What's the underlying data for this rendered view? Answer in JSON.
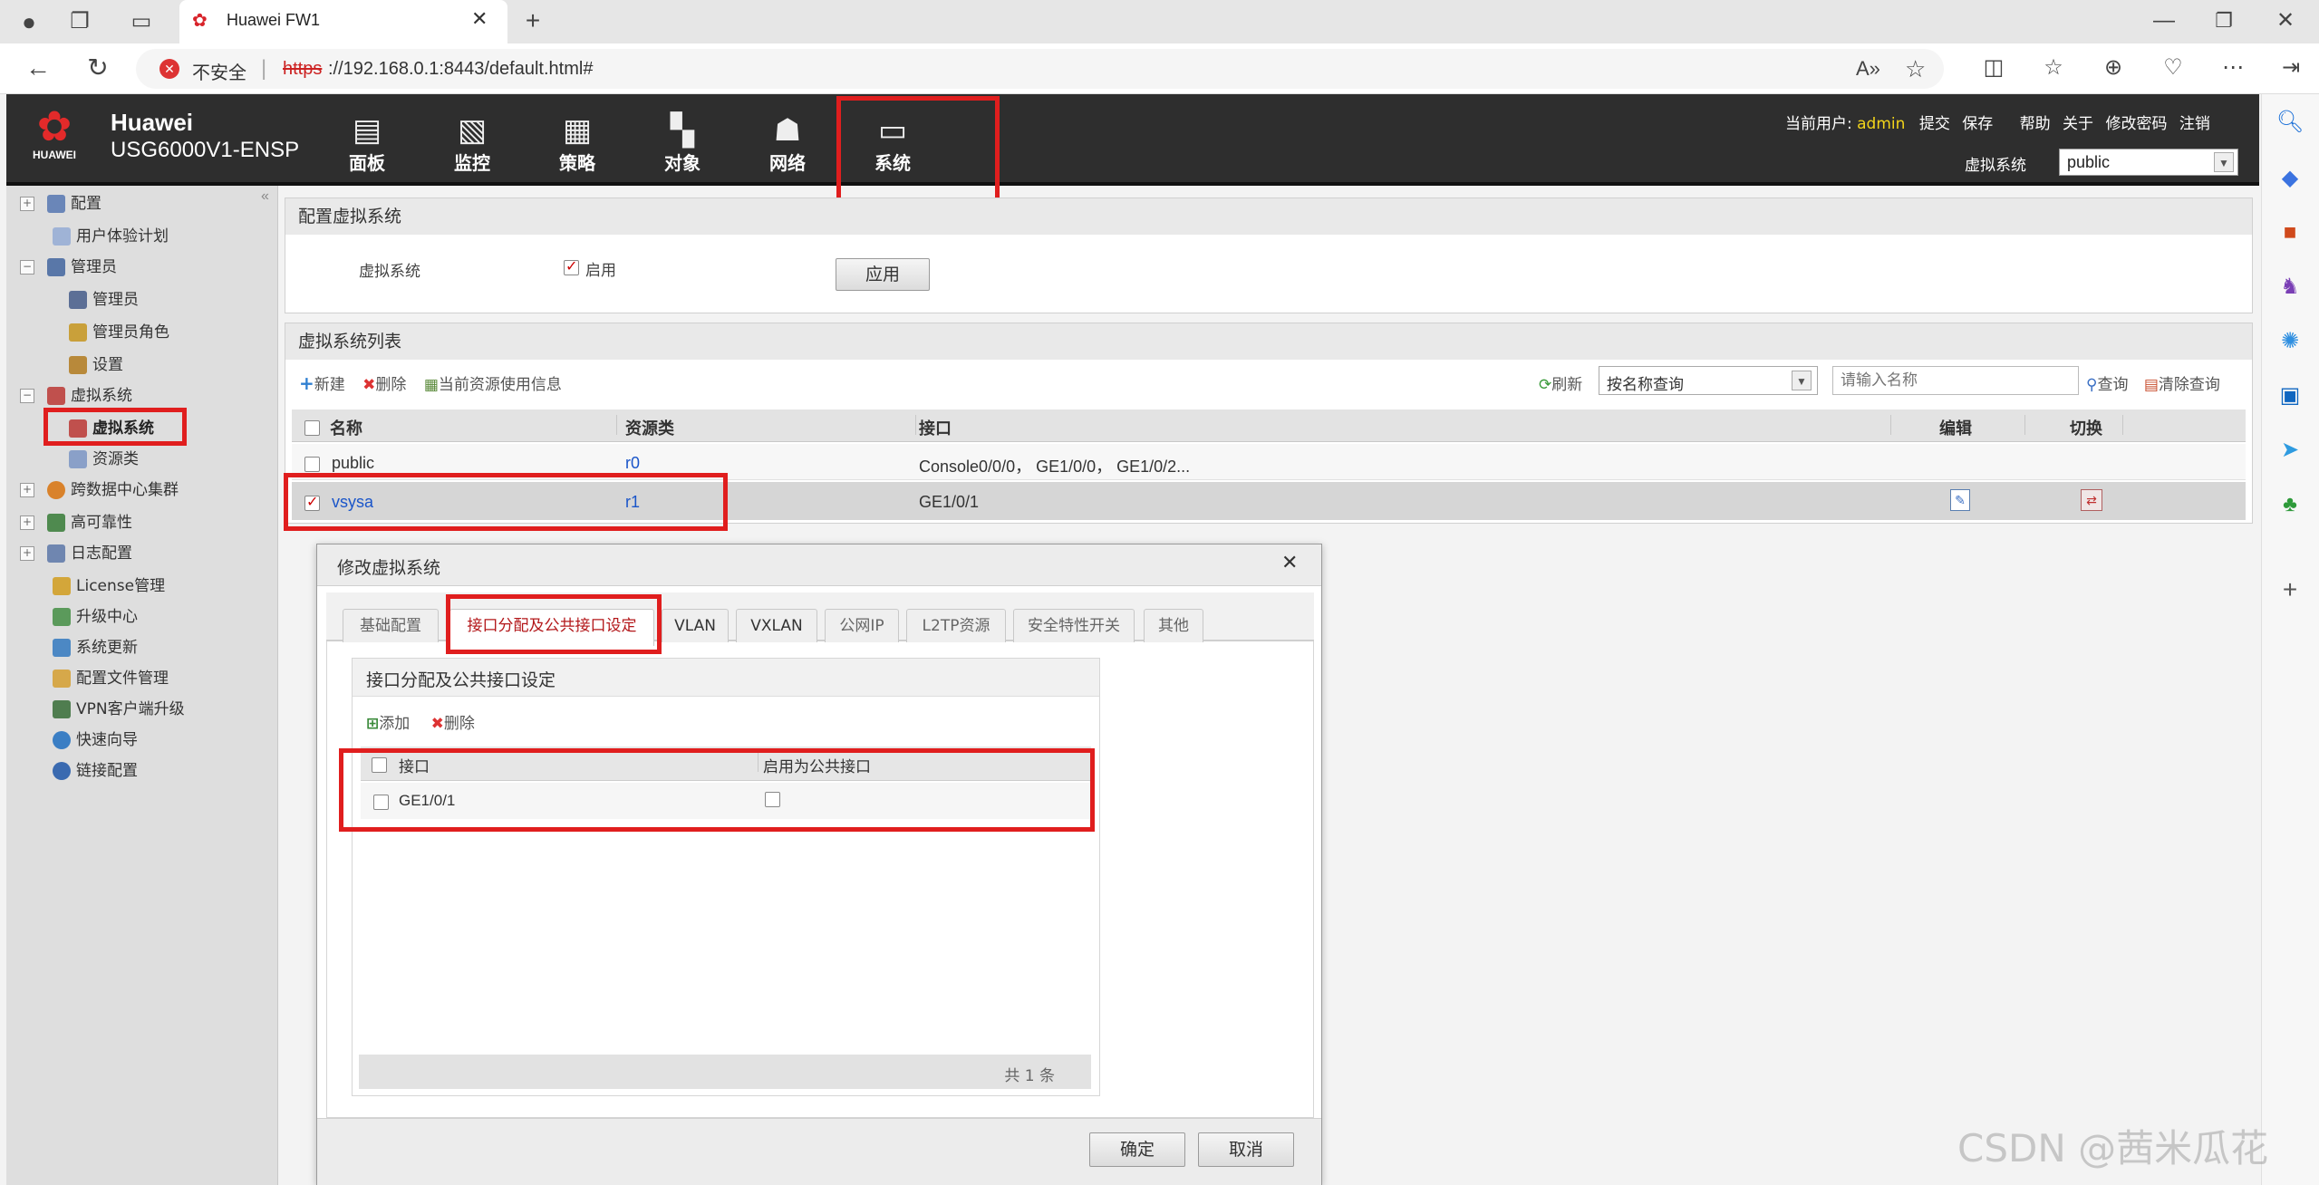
{
  "browser": {
    "tab_title": "Huawei FW1",
    "security_label": "不安全",
    "url_scheme": "https",
    "url_rest": "://192.168.0.1:8443/default.html#"
  },
  "header": {
    "brand": "Huawei",
    "logo_text": "HUAWEI",
    "model": "USG6000V1-ENSP",
    "nav": [
      {
        "label": "面板",
        "icon": "dashboard-icon"
      },
      {
        "label": "监控",
        "icon": "monitor-icon"
      },
      {
        "label": "策略",
        "icon": "policy-icon"
      },
      {
        "label": "对象",
        "icon": "object-icon"
      },
      {
        "label": "网络",
        "icon": "network-icon"
      },
      {
        "label": "系统",
        "icon": "system-icon"
      }
    ],
    "current_user_label": "当前用户:",
    "current_user": "admin",
    "links": [
      "提交",
      "保存",
      "帮助",
      "关于",
      "修改密码",
      "注销"
    ],
    "vsys_label": "虚拟系统",
    "vsys_value": "public"
  },
  "tree": {
    "items": [
      {
        "label": "配置",
        "expander": "+"
      },
      {
        "label": "用户体验计划",
        "expander": ""
      },
      {
        "label": "管理员",
        "expander": "−"
      },
      {
        "label": "管理员",
        "expander": ""
      },
      {
        "label": "管理员角色",
        "expander": ""
      },
      {
        "label": "设置",
        "expander": ""
      },
      {
        "label": "虚拟系统",
        "expander": "−"
      },
      {
        "label": "虚拟系统",
        "expander": ""
      },
      {
        "label": "资源类",
        "expander": ""
      },
      {
        "label": "跨数据中心集群",
        "expander": "+"
      },
      {
        "label": "高可靠性",
        "expander": "+"
      },
      {
        "label": "日志配置",
        "expander": "+"
      },
      {
        "label": "License管理",
        "expander": ""
      },
      {
        "label": "升级中心",
        "expander": ""
      },
      {
        "label": "系统更新",
        "expander": ""
      },
      {
        "label": "配置文件管理",
        "expander": ""
      },
      {
        "label": "VPN客户端升级",
        "expander": ""
      },
      {
        "label": "快速向导",
        "expander": ""
      },
      {
        "label": "链接配置",
        "expander": ""
      }
    ]
  },
  "config_panel": {
    "title": "配置虚拟系统",
    "field_label": "虚拟系统",
    "enable_label": "启用",
    "apply_label": "应用"
  },
  "list_panel": {
    "title": "虚拟系统列表",
    "toolbar": {
      "new": "新建",
      "delete": "删除",
      "usage": "当前资源使用信息",
      "refresh": "刷新",
      "query_type": "按名称查询",
      "search_placeholder": "请输入名称",
      "query": "查询",
      "clear": "清除查询"
    },
    "columns": [
      "名称",
      "资源类",
      "接口",
      "编辑",
      "切换"
    ],
    "rows": [
      {
        "name": "public",
        "resource": "r0",
        "interfaces": "Console0/0/0， GE1/0/0， GE1/0/2..."
      },
      {
        "name": "vsysa",
        "resource": "r1",
        "interfaces": "GE1/0/1"
      }
    ]
  },
  "dialog": {
    "title": "修改虚拟系统",
    "tabs": [
      "基础配置",
      "接口分配及公共接口设定",
      "VLAN",
      "VXLAN",
      "公网IP",
      "L2TP资源",
      "安全特性开关",
      "其他"
    ],
    "section_title": "接口分配及公共接口设定",
    "add_label": "添加",
    "delete_label": "删除",
    "columns": [
      "接口",
      "启用为公共接口"
    ],
    "rows": [
      {
        "interface": "GE1/0/1"
      }
    ],
    "total_text": "共 1 条",
    "ok_label": "确定",
    "cancel_label": "取消"
  },
  "watermark": "CSDN @茜米瓜花"
}
